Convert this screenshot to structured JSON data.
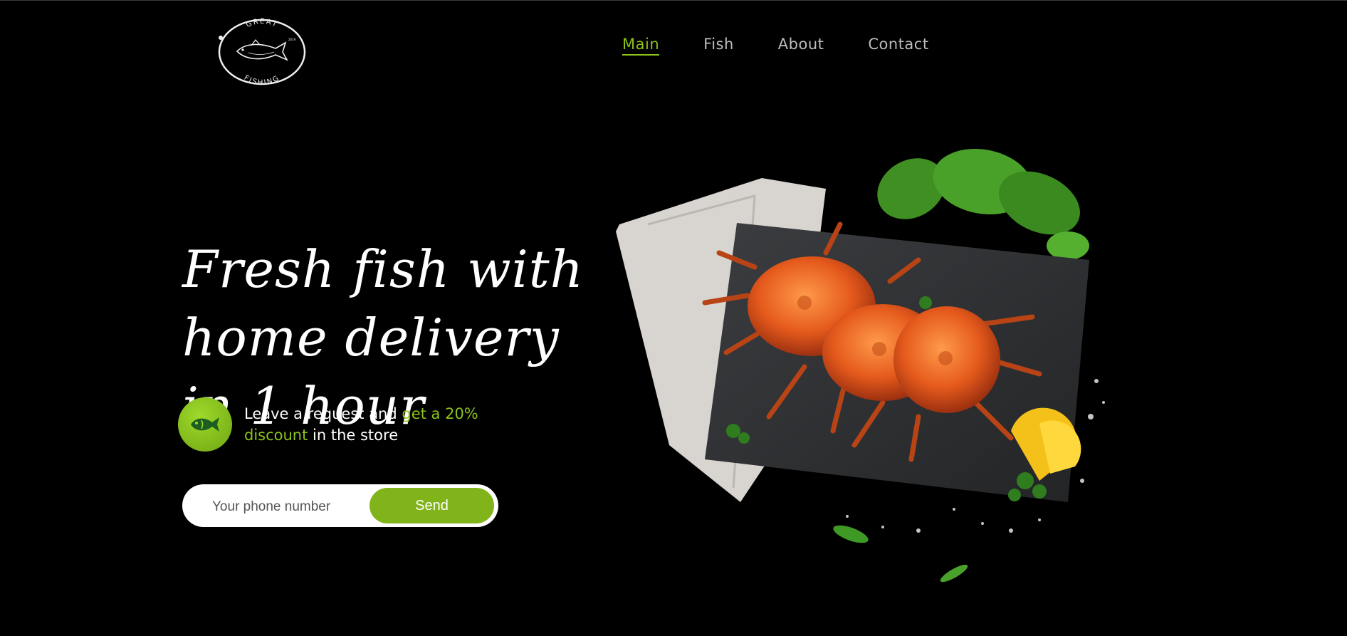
{
  "logo": {
    "top_text": "GREAT",
    "bottom_text": "FISHING",
    "year": "2019"
  },
  "nav": {
    "items": [
      "Main",
      "Fish",
      "About",
      "Contact"
    ],
    "active": "Main"
  },
  "hero": {
    "headline": "Fresh fish with home delivery in 1 hour",
    "promo_prefix": "Leave a request and ",
    "promo_highlight": "get a 20% discount",
    "promo_suffix": " in the store",
    "phone_placeholder": "Your phone number",
    "send_label": "Send"
  },
  "icons": {
    "promo": "fish-icon"
  },
  "colors": {
    "background": "#000000",
    "accent": "#8bc21b",
    "button": "#80b41a",
    "nav_text": "#bdbdbd"
  }
}
